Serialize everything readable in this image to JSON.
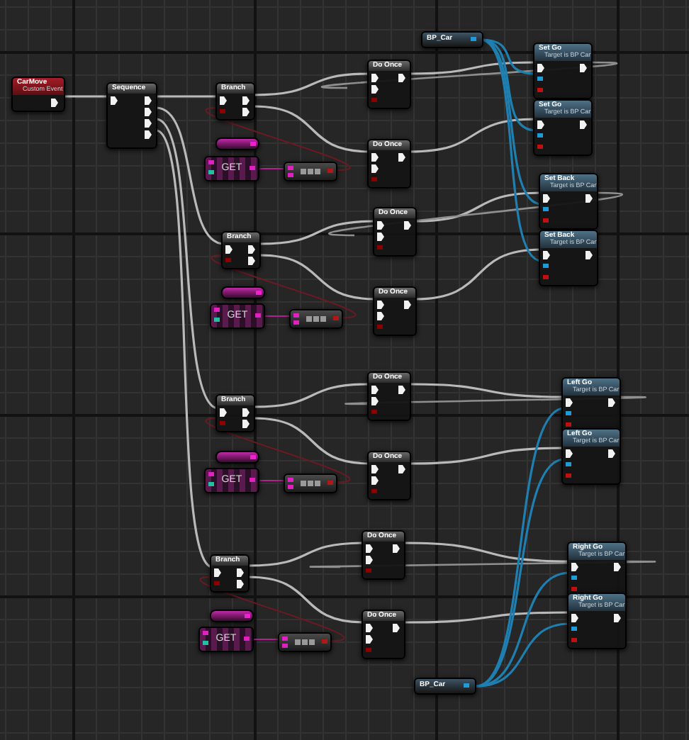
{
  "nodes": [
    {
      "kind": "event",
      "title": "CarMove",
      "subtitle": "Custom Event"
    },
    {
      "kind": "sequence",
      "title": "Sequence"
    },
    {
      "kind": "getter",
      "title": "BP_Car"
    },
    {
      "kind": "branch",
      "title": "Branch"
    },
    {
      "kind": "variable"
    },
    {
      "kind": "get",
      "label": "GET"
    },
    {
      "kind": "compare"
    },
    {
      "kind": "branch",
      "title": "Branch"
    },
    {
      "kind": "variable"
    },
    {
      "kind": "get",
      "label": "GET"
    },
    {
      "kind": "compare"
    },
    {
      "kind": "branch",
      "title": "Branch"
    },
    {
      "kind": "variable"
    },
    {
      "kind": "get",
      "label": "GET"
    },
    {
      "kind": "compare"
    },
    {
      "kind": "branch",
      "title": "Branch"
    },
    {
      "kind": "variable"
    },
    {
      "kind": "get",
      "label": "GET"
    },
    {
      "kind": "compare"
    },
    {
      "kind": "doonce",
      "title": "Do Once"
    },
    {
      "kind": "doonce",
      "title": "Do Once"
    },
    {
      "kind": "doonce",
      "title": "Do Once"
    },
    {
      "kind": "doonce",
      "title": "Do Once"
    },
    {
      "kind": "doonce",
      "title": "Do Once"
    },
    {
      "kind": "doonce",
      "title": "Do Once"
    },
    {
      "kind": "doonce",
      "title": "Do Once"
    },
    {
      "kind": "doonce",
      "title": "Do Once"
    },
    {
      "kind": "set",
      "title": "Set Go",
      "subtitle": "Target is BP Car"
    },
    {
      "kind": "set",
      "title": "Set Go",
      "subtitle": "Target is BP Car"
    },
    {
      "kind": "set",
      "title": "Set Back",
      "subtitle": "Target is BP Car"
    },
    {
      "kind": "set",
      "title": "Set Back",
      "subtitle": "Target is BP Car"
    },
    {
      "kind": "set",
      "title": "Left Go",
      "subtitle": "Target is BP Car"
    },
    {
      "kind": "set",
      "title": "Left Go",
      "subtitle": "Target is BP Car"
    },
    {
      "kind": "set",
      "title": "Right Go",
      "subtitle": "Target is BP Car"
    },
    {
      "kind": "set",
      "title": "Right Go",
      "subtitle": "Target is BP Car"
    },
    {
      "kind": "getter",
      "title": "BP_Car"
    }
  ]
}
